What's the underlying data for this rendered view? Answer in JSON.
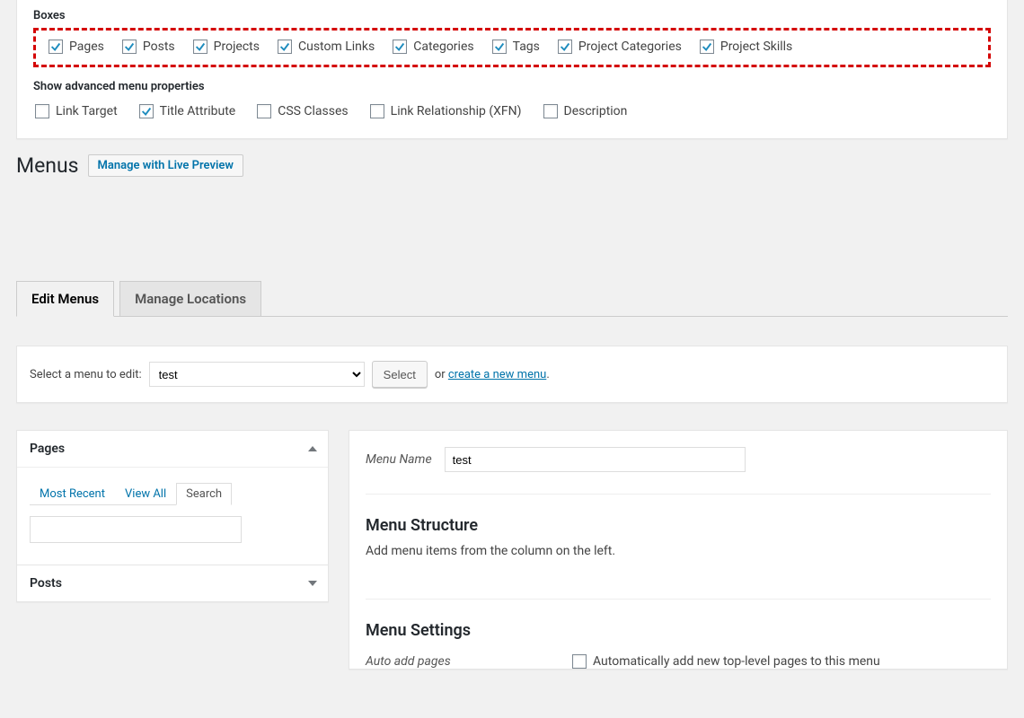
{
  "boxes": {
    "label": "Boxes",
    "items": [
      {
        "label": "Pages",
        "checked": true
      },
      {
        "label": "Posts",
        "checked": true
      },
      {
        "label": "Projects",
        "checked": true
      },
      {
        "label": "Custom Links",
        "checked": true
      },
      {
        "label": "Categories",
        "checked": true
      },
      {
        "label": "Tags",
        "checked": true
      },
      {
        "label": "Project Categories",
        "checked": true
      },
      {
        "label": "Project Skills",
        "checked": true
      }
    ]
  },
  "advanced": {
    "label": "Show advanced menu properties",
    "items": [
      {
        "label": "Link Target",
        "checked": false
      },
      {
        "label": "Title Attribute",
        "checked": true
      },
      {
        "label": "CSS Classes",
        "checked": false
      },
      {
        "label": "Link Relationship (XFN)",
        "checked": false
      },
      {
        "label": "Description",
        "checked": false
      }
    ]
  },
  "header": {
    "title": "Menus",
    "live_preview": "Manage with Live Preview"
  },
  "tabs": {
    "edit": "Edit Menus",
    "locations": "Manage Locations",
    "active": "edit"
  },
  "selector": {
    "label": "Select a menu to edit:",
    "options": [
      "test"
    ],
    "selected": "test",
    "select_btn": "Select",
    "or": "or",
    "create_link": "create a new menu",
    "period": "."
  },
  "left": {
    "pages_title": "Pages",
    "posts_title": "Posts",
    "subtabs": {
      "recent": "Most Recent",
      "view_all": "View All",
      "search": "Search",
      "active": "search"
    }
  },
  "right": {
    "name_label": "Menu Name",
    "name_value": "test",
    "structure_heading": "Menu Structure",
    "structure_help": "Add menu items from the column on the left.",
    "settings_heading": "Menu Settings",
    "auto_add_label": "Auto add pages",
    "auto_add_text": "Automatically add new top-level pages to this menu",
    "auto_add_checked": false
  }
}
